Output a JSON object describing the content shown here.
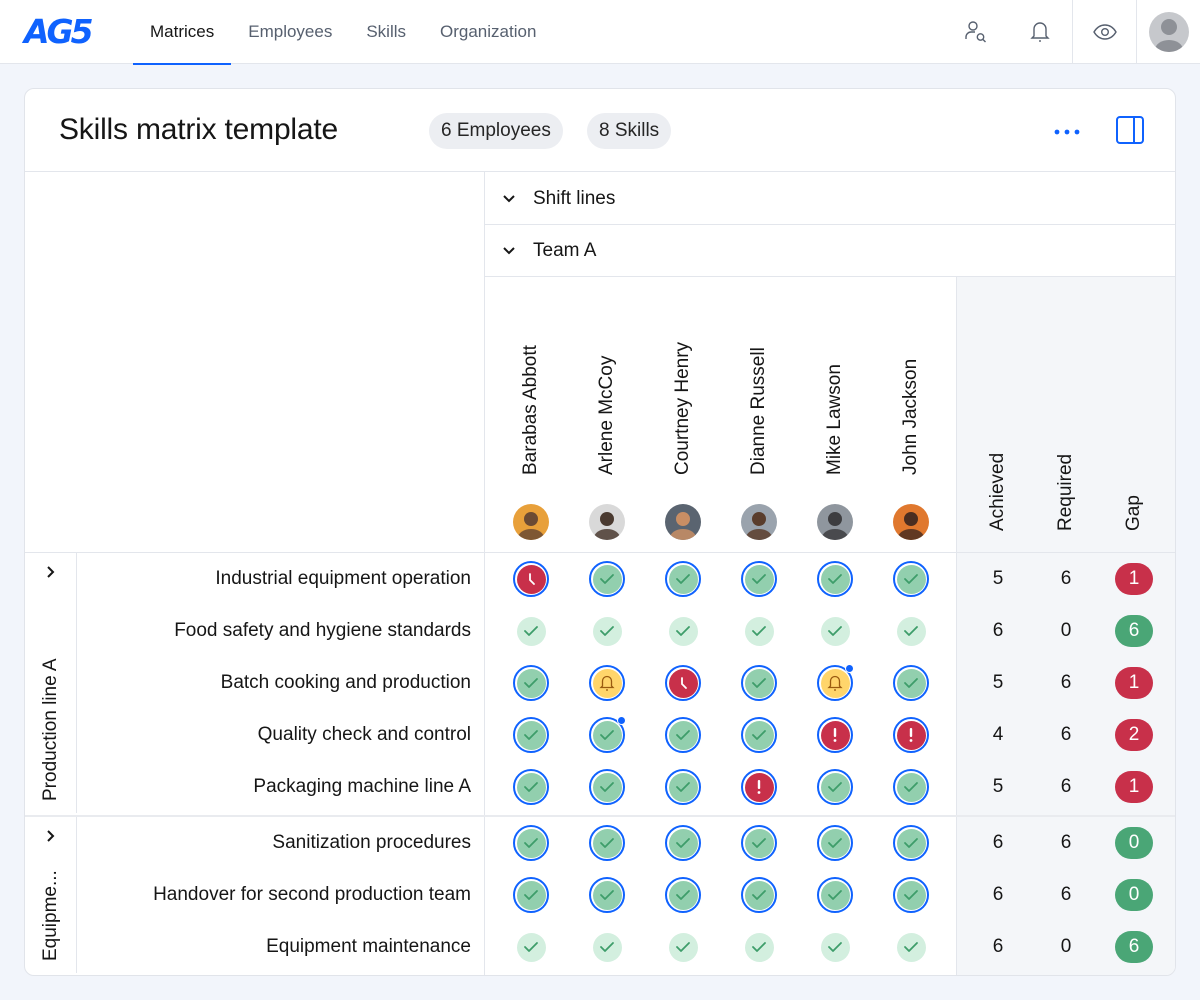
{
  "app": {
    "logo": "AG5",
    "nav": [
      {
        "label": "Matrices",
        "active": true
      },
      {
        "label": "Employees",
        "active": false
      },
      {
        "label": "Skills",
        "active": false
      },
      {
        "label": "Organization",
        "active": false
      }
    ],
    "icons": [
      "user-search-icon",
      "bell-icon",
      "eye-icon",
      "user-avatar"
    ]
  },
  "header": {
    "title": "Skills matrix template",
    "employees_pill": "6 Employees",
    "skills_pill": "8 Skills",
    "more_icon": "more-horizontal-icon",
    "panel_icon": "side-panel-icon"
  },
  "groups_header": [
    {
      "label": "Shift lines",
      "expanded": true
    },
    {
      "label": "Team A",
      "expanded": true
    }
  ],
  "employees": [
    {
      "name": "Barabas Abbott",
      "avatar_colors": [
        "#6b4a33",
        "#e8a03a"
      ]
    },
    {
      "name": "Arlene McCoy",
      "avatar_colors": [
        "#4a3a30",
        "#d9d9d9"
      ]
    },
    {
      "name": "Courtney Henry",
      "avatar_colors": [
        "#c98e64",
        "#5a6470"
      ]
    },
    {
      "name": "Dianne Russell",
      "avatar_colors": [
        "#5a3d2c",
        "#9aa3ad"
      ]
    },
    {
      "name": "Mike Lawson",
      "avatar_colors": [
        "#3d3d40",
        "#8f969e"
      ]
    },
    {
      "name": "John Jackson",
      "avatar_colors": [
        "#4a2d20",
        "#e0782e"
      ]
    }
  ],
  "summary_headers": {
    "achieved": "Achieved",
    "required": "Required",
    "gap": "Gap"
  },
  "colors": {
    "accent": "#0f62fe",
    "achieved_fill": "#92cfae",
    "achieved_light": "#d3efdf",
    "check_stroke": "#3e9d6a",
    "expired_fill": "#c8304a",
    "warning_fill": "#ffd56b",
    "warning_stroke": "#9a5b10",
    "gap_red": "#c8304a",
    "gap_green": "#4aa676"
  },
  "skill_groups": [
    {
      "label": "Production line A",
      "skills": [
        {
          "name": "Industrial equipment operation",
          "cells": [
            {
              "s": "expired",
              "r": true
            },
            {
              "s": "ok",
              "r": true
            },
            {
              "s": "ok",
              "r": true
            },
            {
              "s": "ok",
              "r": true
            },
            {
              "s": "ok",
              "r": true
            },
            {
              "s": "ok",
              "r": true
            }
          ],
          "achieved": "5",
          "required": "6",
          "gap": "1",
          "gap_state": "bad"
        },
        {
          "name": "Food safety and hygiene standards",
          "cells": [
            {
              "s": "light"
            },
            {
              "s": "light"
            },
            {
              "s": "light"
            },
            {
              "s": "light"
            },
            {
              "s": "light"
            },
            {
              "s": "light"
            }
          ],
          "achieved": "6",
          "required": "0",
          "gap": "6",
          "gap_state": "good"
        },
        {
          "name": "Batch cooking and production",
          "cells": [
            {
              "s": "ok",
              "r": true
            },
            {
              "s": "warning",
              "r": true
            },
            {
              "s": "expired",
              "r": true
            },
            {
              "s": "ok",
              "r": true
            },
            {
              "s": "warning",
              "r": true,
              "dot": true
            },
            {
              "s": "ok",
              "r": true
            }
          ],
          "achieved": "5",
          "required": "6",
          "gap": "1",
          "gap_state": "bad"
        },
        {
          "name": "Quality check and control",
          "cells": [
            {
              "s": "ok",
              "r": true
            },
            {
              "s": "ok",
              "r": true,
              "dot": true
            },
            {
              "s": "ok",
              "r": true
            },
            {
              "s": "ok",
              "r": true
            },
            {
              "s": "missing",
              "r": true
            },
            {
              "s": "missing",
              "r": true
            }
          ],
          "achieved": "4",
          "required": "6",
          "gap": "2",
          "gap_state": "bad"
        },
        {
          "name": "Packaging machine line A",
          "cells": [
            {
              "s": "ok",
              "r": true
            },
            {
              "s": "ok",
              "r": true
            },
            {
              "s": "ok",
              "r": true
            },
            {
              "s": "missing",
              "r": true
            },
            {
              "s": "ok",
              "r": true
            },
            {
              "s": "ok",
              "r": true
            }
          ],
          "achieved": "5",
          "required": "6",
          "gap": "1",
          "gap_state": "bad"
        }
      ]
    },
    {
      "label": "Equipme...",
      "skills": [
        {
          "name": "Sanitization procedures",
          "cells": [
            {
              "s": "ok",
              "r": true
            },
            {
              "s": "ok",
              "r": true
            },
            {
              "s": "ok",
              "r": true
            },
            {
              "s": "ok",
              "r": true
            },
            {
              "s": "ok",
              "r": true
            },
            {
              "s": "ok",
              "r": true
            }
          ],
          "achieved": "6",
          "required": "6",
          "gap": "0",
          "gap_state": "good"
        },
        {
          "name": "Handover for second production team",
          "cells": [
            {
              "s": "ok",
              "r": true
            },
            {
              "s": "ok",
              "r": true
            },
            {
              "s": "ok",
              "r": true
            },
            {
              "s": "ok",
              "r": true
            },
            {
              "s": "ok",
              "r": true
            },
            {
              "s": "ok",
              "r": true
            }
          ],
          "achieved": "6",
          "required": "6",
          "gap": "0",
          "gap_state": "good"
        },
        {
          "name": "Equipment maintenance",
          "cells": [
            {
              "s": "light"
            },
            {
              "s": "light"
            },
            {
              "s": "light"
            },
            {
              "s": "light"
            },
            {
              "s": "light"
            },
            {
              "s": "light"
            }
          ],
          "achieved": "6",
          "required": "0",
          "gap": "6",
          "gap_state": "good"
        }
      ]
    }
  ]
}
